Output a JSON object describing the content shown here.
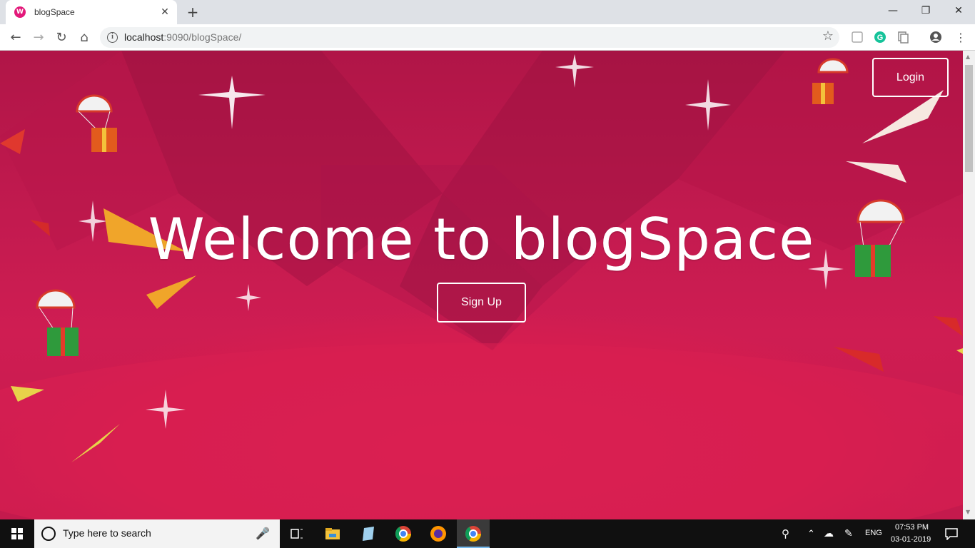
{
  "browser": {
    "tab_title": "blogSpace",
    "url_host": "localhost",
    "url_path": ":9090/blogSpace/"
  },
  "page": {
    "heading": "Welcome to blogSpace",
    "login_label": "Login",
    "signup_label": "Sign Up",
    "background_color": "#c81a4f"
  },
  "taskbar": {
    "search_placeholder": "Type here to search",
    "language": "ENG",
    "time": "07:53 PM",
    "date": "03-01-2019"
  }
}
